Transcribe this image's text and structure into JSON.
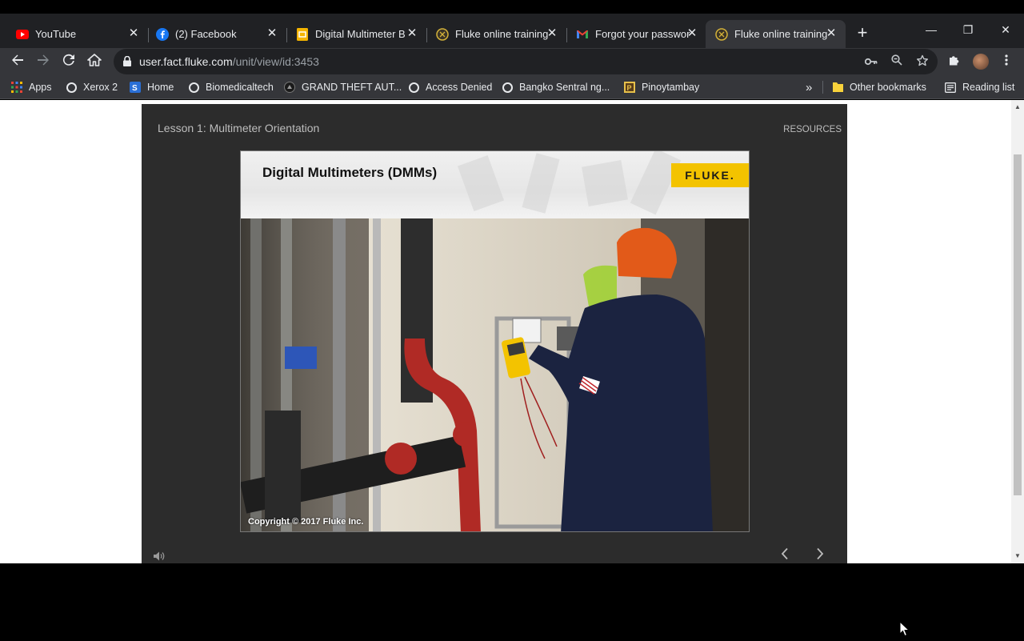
{
  "tabs": [
    {
      "title": "YouTube",
      "icon": "youtube-icon",
      "close": "✕"
    },
    {
      "title": "(2) Facebook",
      "icon": "facebook-icon",
      "close": "✕"
    },
    {
      "title": "Digital Multimeter B",
      "icon": "slides-icon",
      "close": "✕"
    },
    {
      "title": "Fluke online training",
      "icon": "fluke-icon",
      "close": "✕"
    },
    {
      "title": "Forgot your passwor",
      "icon": "gmail-icon",
      "close": "✕"
    },
    {
      "title": "Fluke online training",
      "icon": "fluke-icon",
      "close": "✕",
      "active": true
    }
  ],
  "address": {
    "host": "user.fact.fluke.com",
    "path": "/unit/view/id:3453"
  },
  "bookmarks": [
    {
      "label": "Apps",
      "icon": "apps-grid-icon"
    },
    {
      "label": "Xerox 2",
      "icon": "globe-icon"
    },
    {
      "label": "Home",
      "icon": "site-icon"
    },
    {
      "label": "Biomedicaltech",
      "icon": "globe-icon"
    },
    {
      "label": "GRAND THEFT AUT...",
      "icon": "game-icon"
    },
    {
      "label": "Access Denied",
      "icon": "globe-icon"
    },
    {
      "label": "Bangko Sentral ng...",
      "icon": "globe-icon"
    },
    {
      "label": "Pinoytambay",
      "icon": "site-icon"
    }
  ],
  "bookmarks_more": "»",
  "other_bookmarks": "Other bookmarks",
  "reading_list": "Reading list",
  "player": {
    "lesson_title": "Lesson 1: Multimeter Orientation",
    "resources_label": "RESOURCES",
    "slide_title": "Digital Multimeters (DMMs)",
    "logo_text": "FLUKE.",
    "copyright": "Copyright © 2017 Fluke Inc."
  },
  "colors": {
    "brand_yellow": "#f3c300",
    "player_bg": "#2c2c2c",
    "chrome_dark": "#202124",
    "chrome_toolbar": "#35363a"
  }
}
